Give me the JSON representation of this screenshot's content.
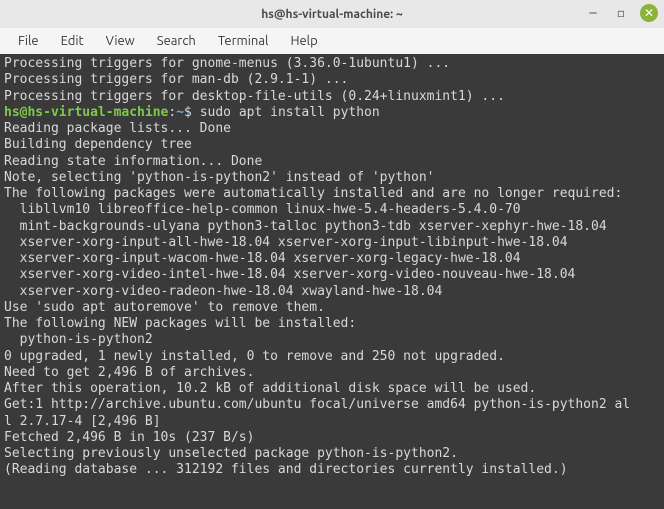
{
  "window": {
    "title": "hs@hs-virtual-machine: ~"
  },
  "menubar": {
    "items": [
      "File",
      "Edit",
      "View",
      "Search",
      "Terminal",
      "Help"
    ]
  },
  "prompt": {
    "userhost": "hs@hs-virtual-machine",
    "sep": ":",
    "path": "~",
    "doll": "$ ",
    "command": "sudo apt install python"
  },
  "terminal": {
    "before_prompt": [
      "Processing triggers for gnome-menus (3.36.0-1ubuntu1) ...",
      "Processing triggers for man-db (2.9.1-1) ...",
      "Processing triggers for desktop-file-utils (0.24+linuxmint1) ..."
    ],
    "after_prompt": [
      "Reading package lists... Done",
      "Building dependency tree",
      "Reading state information... Done",
      "Note, selecting 'python-is-python2' instead of 'python'",
      "The following packages were automatically installed and are no longer required:",
      "  libllvm10 libreoffice-help-common linux-hwe-5.4-headers-5.4.0-70",
      "  mint-backgrounds-ulyana python3-talloc python3-tdb xserver-xephyr-hwe-18.04",
      "  xserver-xorg-input-all-hwe-18.04 xserver-xorg-input-libinput-hwe-18.04",
      "  xserver-xorg-input-wacom-hwe-18.04 xserver-xorg-legacy-hwe-18.04",
      "  xserver-xorg-video-intel-hwe-18.04 xserver-xorg-video-nouveau-hwe-18.04",
      "  xserver-xorg-video-radeon-hwe-18.04 xwayland-hwe-18.04",
      "Use 'sudo apt autoremove' to remove them.",
      "The following NEW packages will be installed:",
      "  python-is-python2",
      "0 upgraded, 1 newly installed, 0 to remove and 250 not upgraded.",
      "Need to get 2,496 B of archives.",
      "After this operation, 10.2 kB of additional disk space will be used.",
      "Get:1 http://archive.ubuntu.com/ubuntu focal/universe amd64 python-is-python2 al",
      "l 2.7.17-4 [2,496 B]",
      "Fetched 2,496 B in 10s (237 B/s)",
      "Selecting previously unselected package python-is-python2.",
      "(Reading database ... 312192 files and directories currently installed.)"
    ]
  }
}
